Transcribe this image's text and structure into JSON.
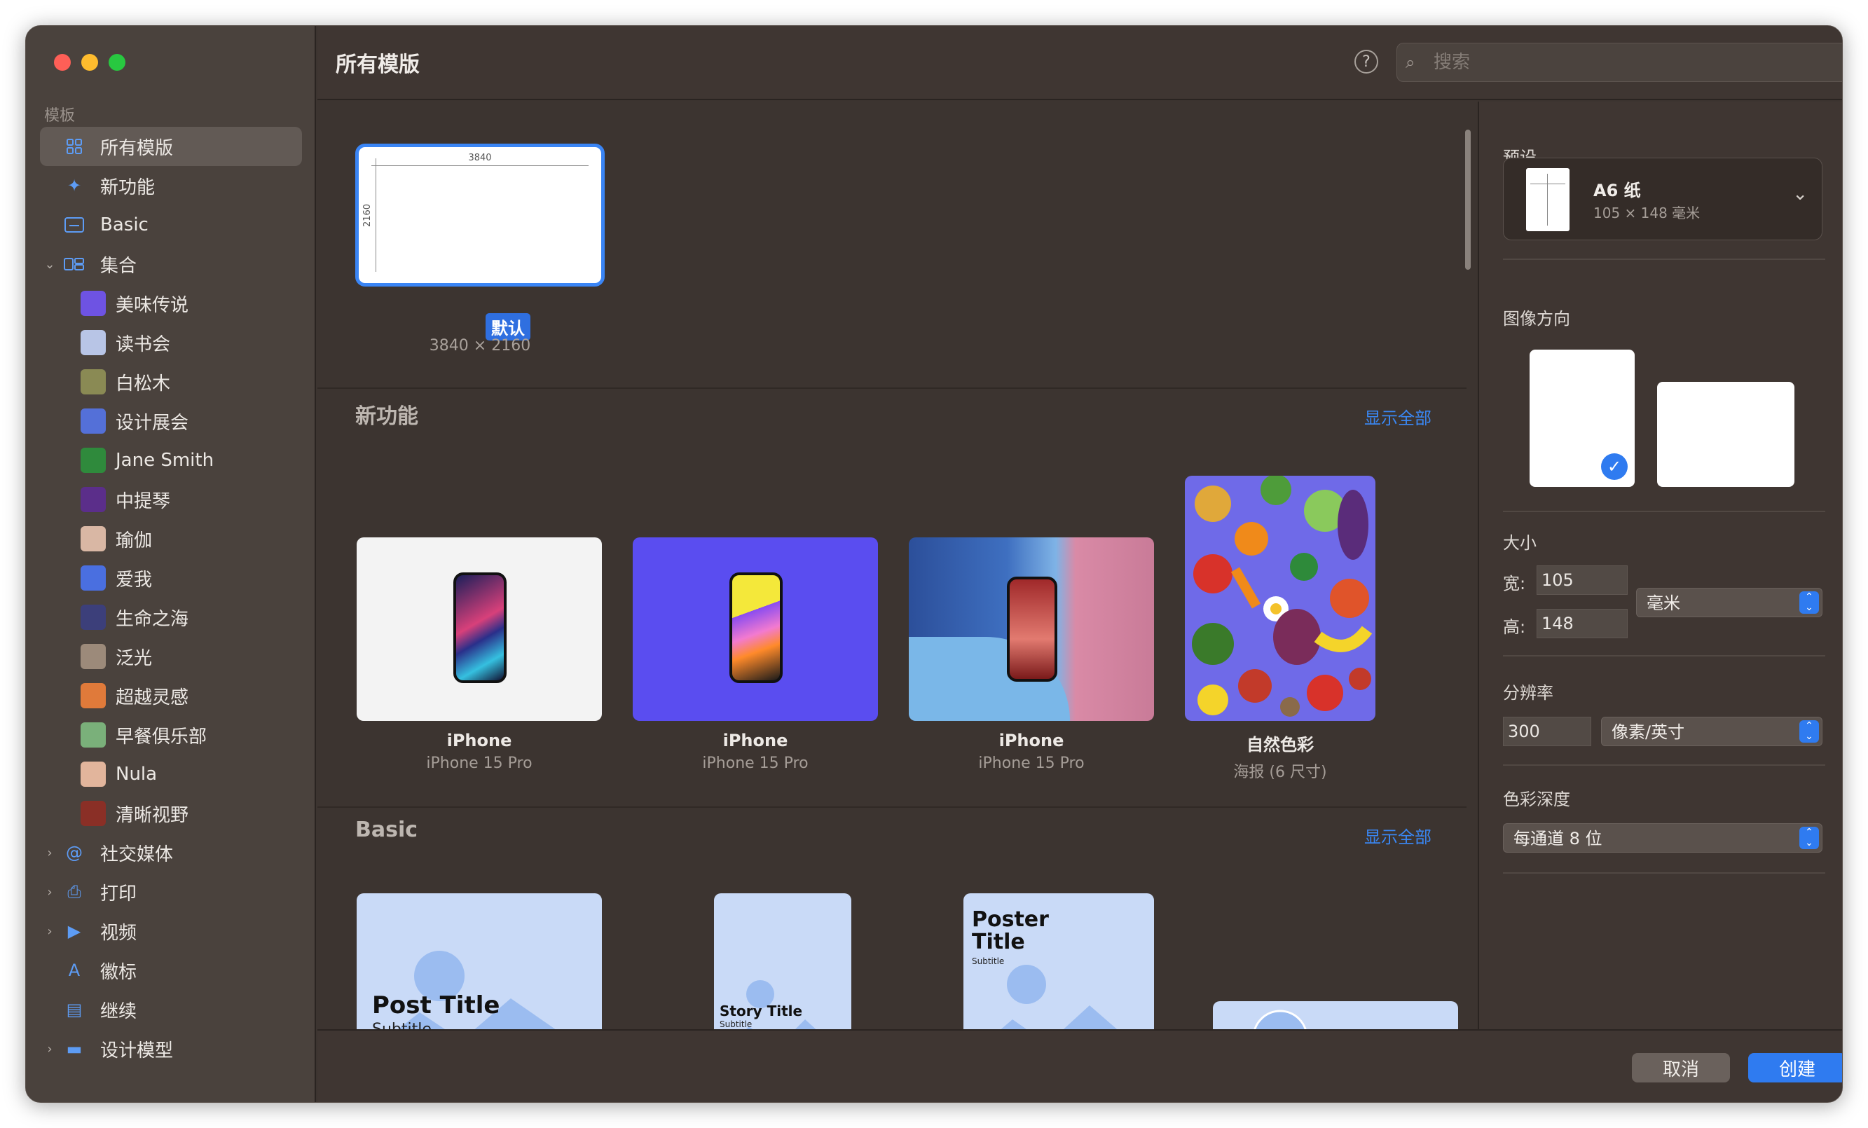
{
  "window": {
    "title": "所有模版"
  },
  "sidebar": {
    "section_label": "模板",
    "items": [
      {
        "label": "所有模版",
        "icon": "grid-icon",
        "selected": true
      },
      {
        "label": "新功能",
        "icon": "sparkles-icon"
      },
      {
        "label": "Basic",
        "icon": "rectangle-icon"
      },
      {
        "label": "集合",
        "icon": "collection-icon",
        "expanded": true
      }
    ],
    "collections": [
      {
        "label": "美味传说",
        "color": "#6e53e3"
      },
      {
        "label": "读书会",
        "color": "#b8c5e6"
      },
      {
        "label": "白松木",
        "color": "#8a8a54"
      },
      {
        "label": "设计展会",
        "color": "#5470d8"
      },
      {
        "label": "Jane Smith",
        "color": "#2f8a3c"
      },
      {
        "label": "中提琴",
        "color": "#5b2e8a"
      },
      {
        "label": "瑜伽",
        "color": "#d9b7a4"
      },
      {
        "label": "爱我",
        "color": "#4a6fe0"
      },
      {
        "label": "生命之海",
        "color": "#3c3f7a"
      },
      {
        "label": "泛光",
        "color": "#9c8a7a"
      },
      {
        "label": "超越灵感",
        "color": "#e07a3a"
      },
      {
        "label": "早餐俱乐部",
        "color": "#7ab07a"
      },
      {
        "label": "Nula",
        "color": "#e2b59c"
      },
      {
        "label": "清晰视野",
        "color": "#8a2f26"
      }
    ],
    "bottom_items": [
      {
        "label": "社交媒体",
        "icon": "at-icon",
        "chevron": true
      },
      {
        "label": "打印",
        "icon": "printer-icon",
        "chevron": true
      },
      {
        "label": "视频",
        "icon": "video-icon",
        "chevron": true
      },
      {
        "label": "徽标",
        "icon": "letter-a-icon",
        "chevron": false
      },
      {
        "label": "继续",
        "icon": "document-icon",
        "chevron": false
      },
      {
        "label": "设计模型",
        "icon": "display-icon",
        "chevron": true
      }
    ]
  },
  "header": {
    "title": "所有模版",
    "search_placeholder": "搜索"
  },
  "default_template": {
    "width_label": "3840",
    "height_label": "2160",
    "badge": "默认",
    "size": "3840 × 2160"
  },
  "sections": {
    "new": {
      "title": "新功能",
      "show_all": "显示全部"
    },
    "basic": {
      "title": "Basic",
      "show_all": "显示全部"
    }
  },
  "new_templates": [
    {
      "name": "iPhone",
      "sub": "iPhone 15 Pro"
    },
    {
      "name": "iPhone",
      "sub": "iPhone 15 Pro"
    },
    {
      "name": "iPhone",
      "sub": "iPhone 15 Pro"
    },
    {
      "name": "自然色彩",
      "sub": "海报 (6 尺寸)"
    }
  ],
  "basic_templates": [
    {
      "title": "Post Title",
      "subtitle": "Subtitle"
    },
    {
      "title": "Story Title",
      "subtitle": "Subtitle"
    },
    {
      "title": "Poster\nTitle",
      "subtitle": "Subtitle"
    }
  ],
  "panel": {
    "preset_label": "预设",
    "preset_name": "A6 纸",
    "preset_dims": "105 × 148 毫米",
    "orientation_label": "图像方向",
    "size_label": "大小",
    "width_label": "宽:",
    "width_value": "105",
    "height_label": "高:",
    "height_value": "148",
    "unit": "毫米",
    "resolution_label": "分辨率",
    "resolution_value": "300",
    "resolution_unit": "像素/英寸",
    "depth_label": "色彩深度",
    "depth_value": "每通道 8 位"
  },
  "footer": {
    "cancel": "取消",
    "create": "创建"
  },
  "colors": {
    "accent": "#2f7bf0",
    "background": "#3c3430",
    "sidebar": "#4a423d"
  }
}
